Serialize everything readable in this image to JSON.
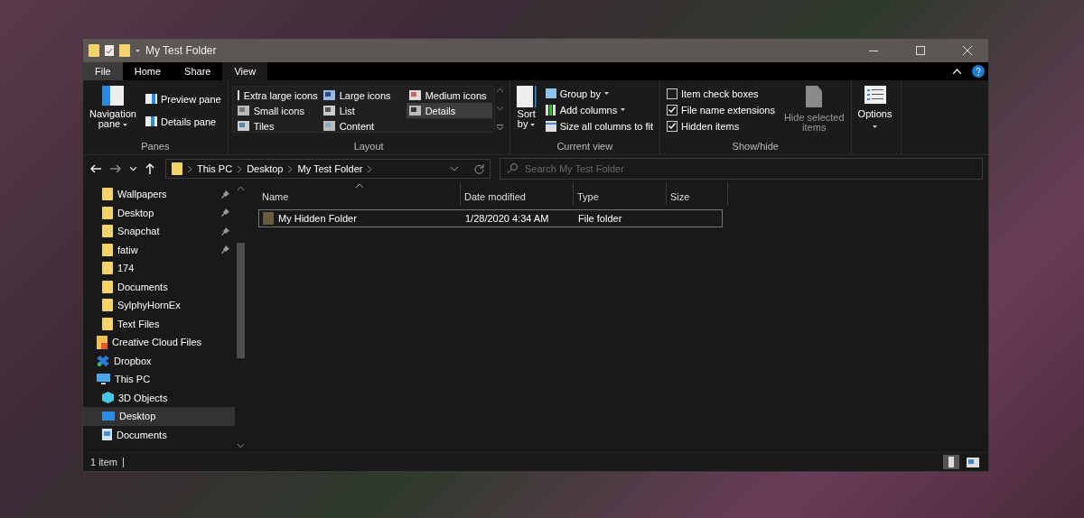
{
  "window": {
    "title": "My Test Folder"
  },
  "tabs": [
    {
      "label": "File",
      "kind": "file",
      "selected": false
    },
    {
      "label": "Home",
      "kind": "tab",
      "selected": false
    },
    {
      "label": "Share",
      "kind": "tab",
      "selected": false
    },
    {
      "label": "View",
      "kind": "tab",
      "selected": true
    }
  ],
  "ribbon": {
    "panes": {
      "label": "Panes",
      "navigation_pane": [
        "Navigation",
        "pane"
      ],
      "items": [
        "Preview pane",
        "Details pane"
      ]
    },
    "layout": {
      "label": "Layout",
      "options": [
        {
          "label": "Extra large icons",
          "kind": "xl",
          "selected": false
        },
        {
          "label": "Large icons",
          "kind": "large",
          "selected": false
        },
        {
          "label": "Medium icons",
          "kind": "medium",
          "selected": false
        },
        {
          "label": "Small icons",
          "kind": "small",
          "selected": false
        },
        {
          "label": "List",
          "kind": "list",
          "selected": false
        },
        {
          "label": "Details",
          "kind": "details",
          "selected": true
        },
        {
          "label": "Tiles",
          "kind": "tiles",
          "selected": false
        },
        {
          "label": "Content",
          "kind": "content",
          "selected": false
        }
      ]
    },
    "current_view": {
      "label": "Current view",
      "sort_by": [
        "Sort",
        "by"
      ],
      "items": [
        {
          "label": "Group by",
          "kind": "group",
          "dropdown": true
        },
        {
          "label": "Add columns",
          "kind": "columns",
          "dropdown": true
        },
        {
          "label": "Size all columns to fit",
          "kind": "fit",
          "dropdown": false
        }
      ]
    },
    "show_hide": {
      "label": "Show/hide",
      "checkboxes": [
        {
          "label": "Item check boxes",
          "checked": false
        },
        {
          "label": "File name extensions",
          "checked": true
        },
        {
          "label": "Hidden items",
          "checked": true
        }
      ],
      "hide_selected": [
        "Hide selected",
        "items"
      ]
    },
    "options": {
      "label": "Options"
    }
  },
  "address": {
    "segments": [
      "This PC",
      "Desktop",
      "My Test Folder"
    ]
  },
  "search": {
    "placeholder": "Search My Test Folder"
  },
  "nav": [
    {
      "label": "Wallpapers",
      "kind": "folder",
      "pinned": true,
      "selected": false
    },
    {
      "label": "Desktop",
      "kind": "folder",
      "pinned": true,
      "selected": false
    },
    {
      "label": "Snapchat",
      "kind": "folder",
      "pinned": true,
      "selected": false
    },
    {
      "label": "fatiw",
      "kind": "folder",
      "pinned": true,
      "selected": false
    },
    {
      "label": "174",
      "kind": "folder",
      "pinned": false,
      "selected": false
    },
    {
      "label": "Documents",
      "kind": "folder",
      "pinned": false,
      "selected": false
    },
    {
      "label": "SylphyHornEx",
      "kind": "folder",
      "pinned": false,
      "selected": false
    },
    {
      "label": "Text Files",
      "kind": "folder",
      "pinned": false,
      "selected": false
    },
    {
      "label": "Creative Cloud Files",
      "kind": "cloud",
      "pinned": false,
      "selected": false
    },
    {
      "label": "Dropbox",
      "kind": "dropbox",
      "pinned": false,
      "selected": false
    },
    {
      "label": "This PC",
      "kind": "pc",
      "pinned": false,
      "selected": false,
      "children": [
        {
          "label": "3D Objects",
          "kind": "cube",
          "pinned": false,
          "selected": false
        },
        {
          "label": "Desktop",
          "kind": "desktop",
          "pinned": false,
          "selected": true
        },
        {
          "label": "Documents",
          "kind": "document",
          "pinned": false,
          "selected": false
        }
      ]
    }
  ],
  "table": {
    "columns": [
      {
        "label": "Name",
        "sorted": true
      },
      {
        "label": "Date modified",
        "sorted": false
      },
      {
        "label": "Type",
        "sorted": false
      },
      {
        "label": "Size",
        "sorted": false
      }
    ],
    "rows": [
      {
        "name": "My Hidden Folder",
        "date": "1/28/2020 4:34 AM",
        "type": "File folder",
        "hidden": true,
        "focused": true
      }
    ]
  },
  "status_bar": {
    "count": "1 item",
    "views": [
      {
        "kind": "details",
        "selected": true
      },
      {
        "kind": "large",
        "selected": false
      }
    ]
  }
}
